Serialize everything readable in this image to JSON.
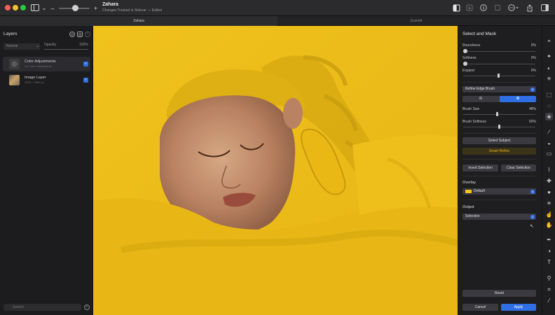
{
  "titlebar": {
    "doc_title": "Zahara",
    "doc_subtitle": "Changes Tracked in Sidecar — Edited",
    "zoom_minus": "–",
    "zoom_plus": "+"
  },
  "tabs": [
    {
      "label": "Zahara",
      "active": true
    },
    {
      "label": "Scarlett",
      "active": false
    }
  ],
  "layers": {
    "title": "Layers",
    "blend_mode": "Normal",
    "opacity_label": "Opacity",
    "opacity_value": "100%",
    "items": [
      {
        "name": "Color Adjustments",
        "sub": "No Color Adjustments",
        "visible": true,
        "selected": true
      },
      {
        "name": "Image Layer",
        "sub": "3333 × 1860 px",
        "visible": true,
        "selected": false
      }
    ],
    "search_placeholder": "Search"
  },
  "select_mask": {
    "title": "Select and Mask",
    "sliders_top": [
      {
        "label": "Roundness",
        "value": "0%",
        "fraction": 0
      },
      {
        "label": "Softness",
        "value": "0%",
        "fraction": 0
      },
      {
        "label": "Expand",
        "value": "0%",
        "fraction": 0.5
      }
    ],
    "brush_select": "Refine Edge Brush",
    "mode_minus": "⊖",
    "mode_plus": "⊕",
    "sliders_brush": [
      {
        "label": "Brush Size",
        "value": "48%",
        "fraction": 0.48
      },
      {
        "label": "Brush Softness",
        "value": "50%",
        "fraction": 0.5
      }
    ],
    "select_subject": "Select Subject",
    "smart_refine": "Smart Refine",
    "invert_selection": "Invert Selection",
    "clear_selection": "Clear Selection",
    "overlay_heading": "Overlay",
    "overlay_value": "Default",
    "overlay_color": "#f5c518",
    "output_heading": "Output",
    "output_value": "Selection",
    "reset": "Reset",
    "cancel": "Cancel",
    "apply": "Apply"
  },
  "colors": {
    "accent": "#2f6fe6",
    "overlay": "#f5c518",
    "smart_refine_text": "#e2b21a"
  }
}
